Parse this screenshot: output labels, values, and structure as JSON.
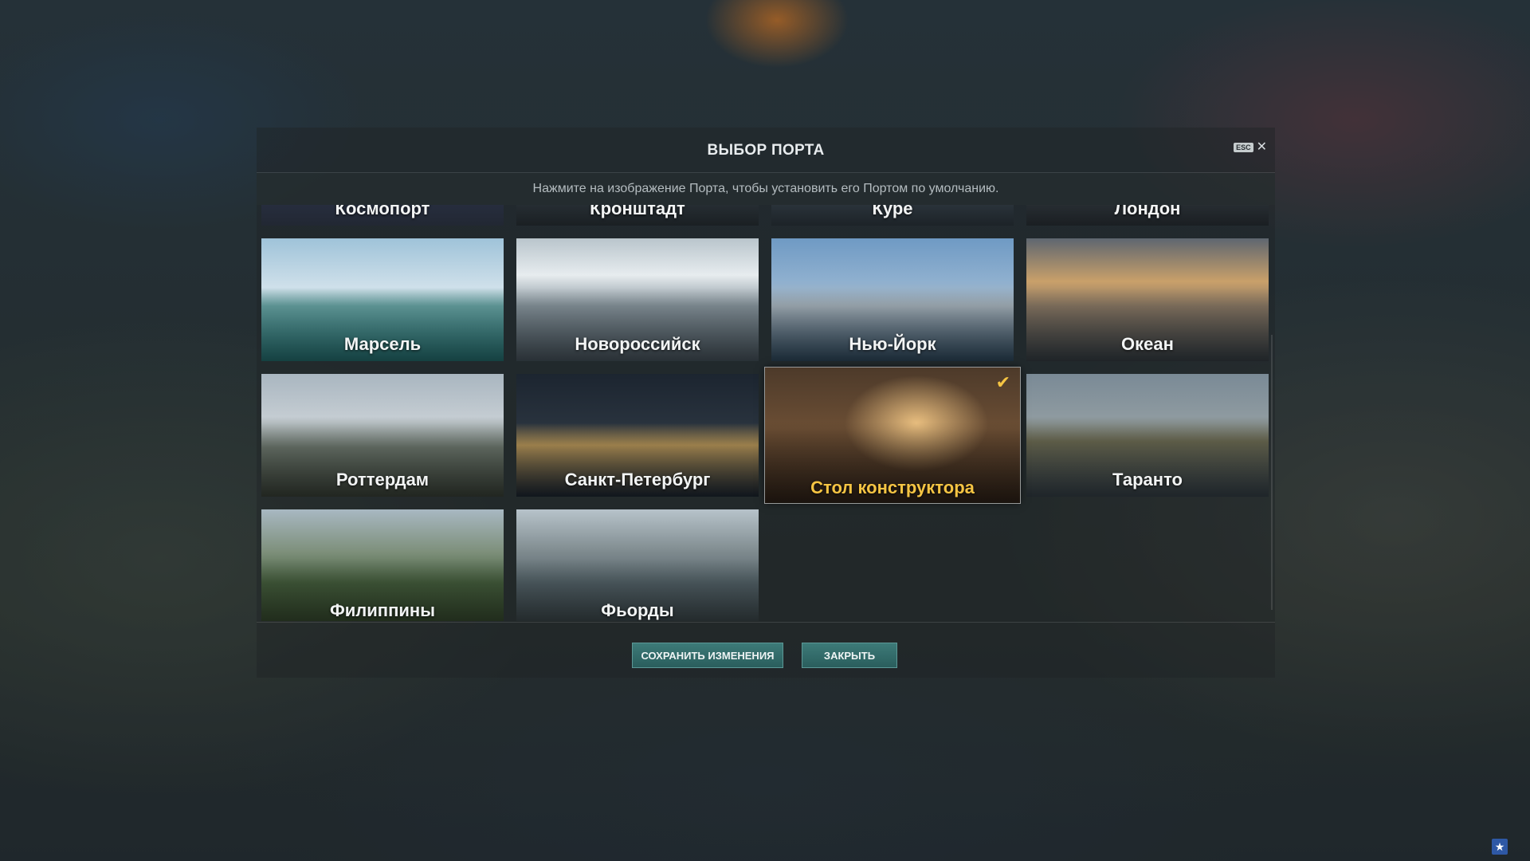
{
  "dialog": {
    "title": "ВЫБОР ПОРТА",
    "esc_label": "ESC",
    "subtitle": "Нажмите на изображение Порта, чтобы установить его Портом по умолчанию."
  },
  "ports": [
    {
      "name": "Космопорт",
      "theme": "space"
    },
    {
      "name": "Кронштадт",
      "theme": "harbor"
    },
    {
      "name": "Куре",
      "theme": "harbor"
    },
    {
      "name": "Лондон",
      "theme": "city"
    },
    {
      "name": "Марсель",
      "theme": "sea"
    },
    {
      "name": "Новороссийск",
      "theme": "snow"
    },
    {
      "name": "Нью-Йорк",
      "theme": "skyline"
    },
    {
      "name": "Океан",
      "theme": "sunset"
    },
    {
      "name": "Роттердам",
      "theme": "city"
    },
    {
      "name": "Санкт-Петербург",
      "theme": "night"
    },
    {
      "name": "Стол конструктора",
      "theme": "desk",
      "selected": true
    },
    {
      "name": "Таранто",
      "theme": "harbor"
    },
    {
      "name": "Филиппины",
      "theme": "jungle"
    },
    {
      "name": "Фьорды",
      "theme": "mountain"
    }
  ],
  "buttons": {
    "save": "СОХРАНИТЬ ИЗМЕНЕНИЯ",
    "close": "ЗАКРЫТЬ"
  },
  "colors": {
    "accent": "#f5c443",
    "button": "#2f6b69"
  }
}
